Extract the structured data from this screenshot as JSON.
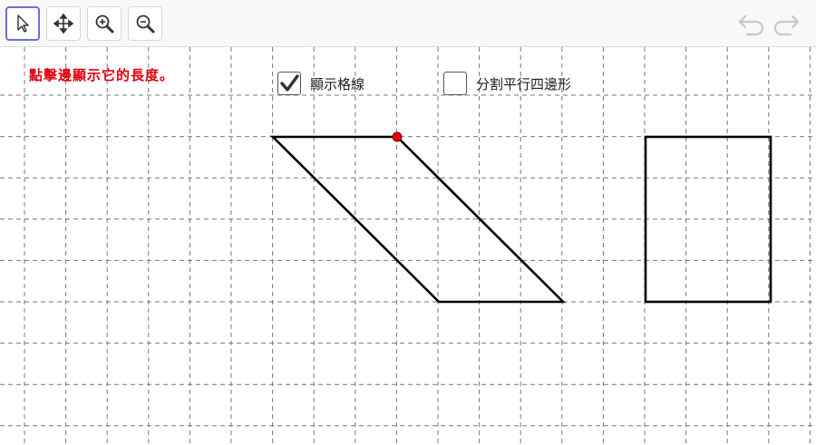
{
  "toolbar": {
    "tools": [
      {
        "name": "select-tool",
        "icon": "arrow-cursor-icon",
        "active": true
      },
      {
        "name": "move-graphics-view-tool",
        "icon": "move-arrows-icon",
        "active": false
      },
      {
        "name": "zoom-in-tool",
        "icon": "zoom-in-icon",
        "active": false
      },
      {
        "name": "zoom-out-tool",
        "icon": "zoom-out-icon",
        "active": false
      }
    ],
    "undo_icon": "undo-icon",
    "redo_icon": "redo-icon"
  },
  "canvas": {
    "instruction": "點擊邊顯示它的長度。",
    "checkbox_grid": {
      "label": "顯示格線",
      "checked": true
    },
    "checkbox_split": {
      "label": "分割平行四邊形",
      "checked": false
    },
    "colors": {
      "instruction": "#e0000c",
      "shape_stroke": "#000000",
      "point_fill": "#e4000f",
      "grid": "#777777",
      "accent": "#6c6fd9"
    },
    "shapes": [
      "parallelogram",
      "rectangle"
    ]
  }
}
